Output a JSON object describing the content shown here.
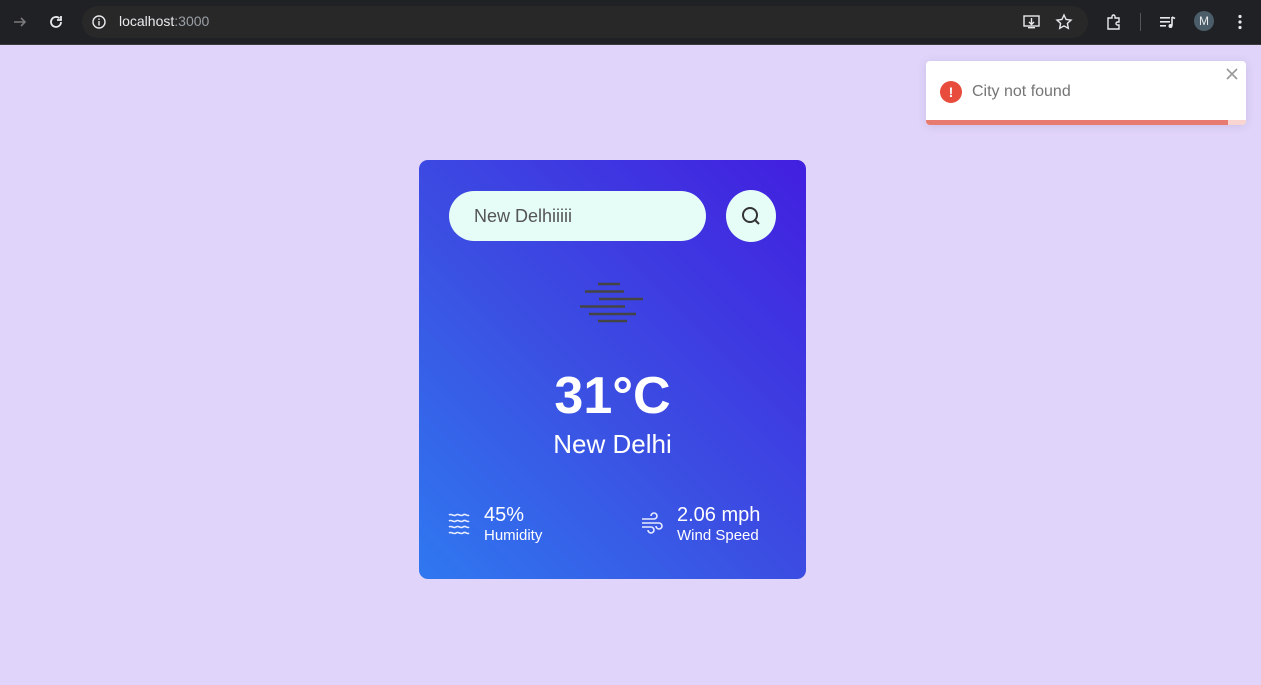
{
  "browser": {
    "host": "localhost",
    "port": ":3000",
    "profile_initial": "M",
    "icons": [
      "forward-icon",
      "reload-icon",
      "site-info-icon",
      "install-app-icon",
      "bookmark-star-icon",
      "extensions-icon",
      "media-controls-icon",
      "kebab-menu-icon"
    ]
  },
  "weather": {
    "search_value": "New Delhiiiii",
    "temperature": "31°C",
    "city": "New Delhi",
    "condition_icon": "mist-icon",
    "humidity": {
      "value": "45%",
      "label": "Humidity",
      "icon": "humidity-waves-icon"
    },
    "wind": {
      "value": "2.06 mph",
      "label": "Wind Speed",
      "icon": "wind-icon"
    }
  },
  "toast": {
    "message": "City not found",
    "type": "error",
    "progress": 0.944,
    "colors": {
      "icon": "#e74c3c",
      "bar": "#e77b6f",
      "track": "#f8d5d1"
    }
  },
  "colors": {
    "page_background": "#e0d4fb",
    "card_gradient_start": "#2f78f0",
    "card_gradient_end": "#421fe0",
    "input_background": "#e6fcf7"
  }
}
